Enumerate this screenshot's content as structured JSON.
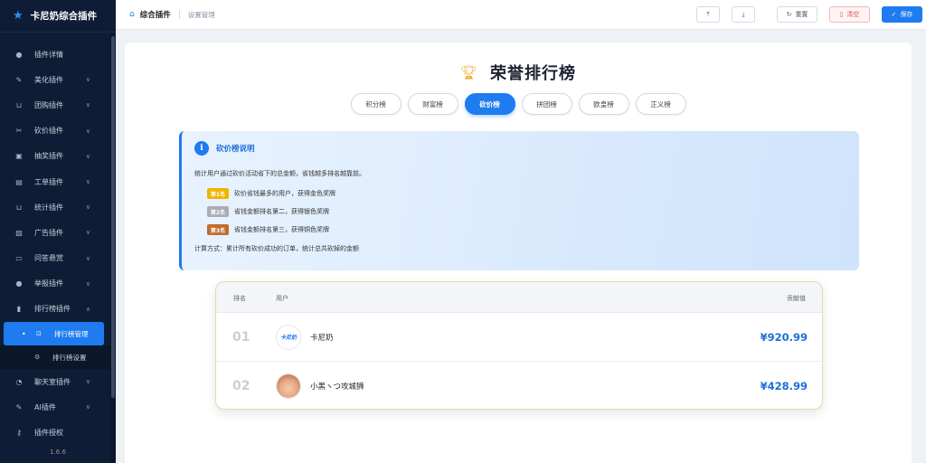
{
  "app": {
    "brand": "卡尼奶综合插件",
    "version": "1.6.6"
  },
  "sidebar": {
    "items": [
      {
        "label": "插件详情",
        "icon": "info-icon"
      },
      {
        "label": "美化插件",
        "icon": "palette-icon"
      },
      {
        "label": "团购插件",
        "icon": "cart-icon"
      },
      {
        "label": "砍价插件",
        "icon": "scissors-icon"
      },
      {
        "label": "抽奖插件",
        "icon": "gift-icon"
      },
      {
        "label": "工单插件",
        "icon": "ticket-icon"
      },
      {
        "label": "统计插件",
        "icon": "cart-stats-icon"
      },
      {
        "label": "广告插件",
        "icon": "image-icon"
      },
      {
        "label": "问答悬赏",
        "icon": "chat-icon"
      },
      {
        "label": "举报插件",
        "icon": "warning-icon"
      },
      {
        "label": "排行榜插件",
        "icon": "bar-chart-icon"
      }
    ],
    "sub_items": [
      {
        "label": "排行榜管理",
        "active": true
      },
      {
        "label": "排行榜设置",
        "active": false
      }
    ],
    "items_after": [
      {
        "label": "聊天室插件",
        "icon": "chat-bubble-icon"
      },
      {
        "label": "AI插件",
        "icon": "ai-icon"
      },
      {
        "label": "插件授权",
        "icon": "key-icon"
      }
    ]
  },
  "topbar": {
    "crumb1": "综合插件",
    "crumb2": "设置管理",
    "buttons": {
      "export": "",
      "import": "",
      "reset": "重置",
      "clear": "清空",
      "save": "保存"
    }
  },
  "page": {
    "title": "荣誉排行榜",
    "tabs": [
      "积分榜",
      "财富榜",
      "砍价榜",
      "拼团榜",
      "欧皇榜",
      "正义榜"
    ],
    "active_tab": "砍价榜"
  },
  "info": {
    "title": "砍价榜说明",
    "desc": "统计用户通过砍价活动省下的总金额，省钱越多排名越靠前。",
    "ranks": [
      {
        "badge": "第1名",
        "text": "砍价省钱最多的用户，获得金色奖牌",
        "color": "#f0b400"
      },
      {
        "badge": "第2名",
        "text": "省钱金额排名第二，获得银色奖牌",
        "color": "#a9adb5"
      },
      {
        "badge": "第3名",
        "text": "省钱金额排名第三，获得铜色奖牌",
        "color": "#c26d2b"
      }
    ],
    "calc": "计算方式：累计所有砍价成功的订单，统计总共砍掉的金额"
  },
  "table": {
    "headers": {
      "rank": "排名",
      "user": "用户",
      "value": "贡献值"
    },
    "rows": [
      {
        "rank": "01",
        "name": "卡尼奶",
        "amount": "¥920.99",
        "avatar": "卡尼奶"
      },
      {
        "rank": "02",
        "name": "小黑ヽつ攻城狮",
        "amount": "¥428.99",
        "avatar": ""
      }
    ]
  },
  "colors": {
    "accent": "#1e7bf0",
    "sidebar_bg": "#0e1d35"
  }
}
